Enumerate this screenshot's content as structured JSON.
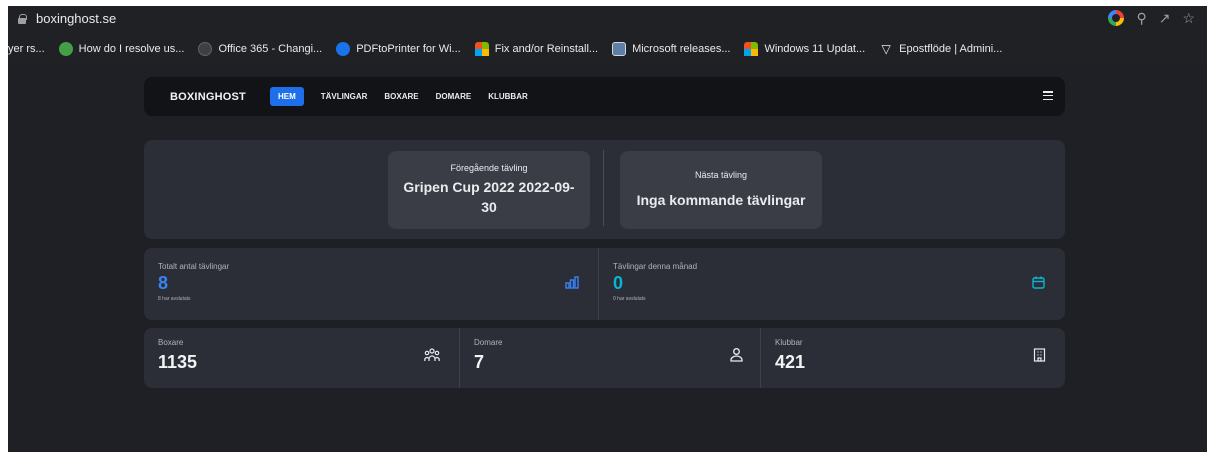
{
  "browser": {
    "url": "boxinghost.se",
    "bookmarks": [
      {
        "label": "yer rs...",
        "icon": "none"
      },
      {
        "label": "How do I resolve us...",
        "icon": "green-circle-icon"
      },
      {
        "label": "Office 365 - Changi...",
        "icon": "globe-icon"
      },
      {
        "label": "PDFtoPrinter for Wi...",
        "icon": "blue-circle-icon"
      },
      {
        "label": "Fix and/or Reinstall...",
        "icon": "microsoft-logo-icon"
      },
      {
        "label": "Microsoft releases...",
        "icon": "news-icon"
      },
      {
        "label": "Windows 11 Updat...",
        "icon": "microsoft-logo-icon"
      },
      {
        "label": "Epostflöde | Admini...",
        "icon": "v-shield-icon"
      }
    ]
  },
  "navbar": {
    "brand": "BOXINGHOST",
    "items": [
      {
        "label": "HEM",
        "active": true
      },
      {
        "label": "TÄVLINGAR",
        "active": false
      },
      {
        "label": "BOXARE",
        "active": false
      },
      {
        "label": "DOMARE",
        "active": false
      },
      {
        "label": "KLUBBAR",
        "active": false
      }
    ]
  },
  "competitions": {
    "previous": {
      "label": "Föregående tävling",
      "value_line1": "Gripen Cup 2022 2022-09-",
      "value_line2": "30"
    },
    "next": {
      "label": "Nästa tävling",
      "value": "Inga kommande tävlingar"
    }
  },
  "stats": {
    "total": {
      "label": "Totalt antal tävlingar",
      "value": "8",
      "sub": "8 har avslutats",
      "icon": "bar-chart-icon",
      "color": "#3b82f6"
    },
    "month": {
      "label": "Tävlingar denna månad",
      "value": "0",
      "sub": "0 har avslutats",
      "icon": "calendar-icon",
      "color": "#06b6d4"
    }
  },
  "counts": {
    "boxare": {
      "label": "Boxare",
      "value": "1135",
      "icon": "people-icon"
    },
    "domare": {
      "label": "Domare",
      "value": "7",
      "icon": "person-icon"
    },
    "klubbar": {
      "label": "Klubbar",
      "value": "421",
      "icon": "building-icon"
    }
  }
}
